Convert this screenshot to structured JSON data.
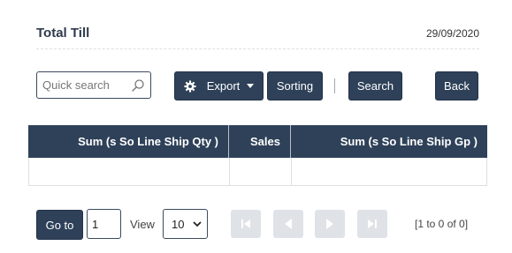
{
  "header": {
    "title": "Total Till",
    "date": "29/09/2020"
  },
  "toolbar": {
    "search_placeholder": "Quick search",
    "search_value": "",
    "export_label": "Export",
    "sorting_label": "Sorting",
    "search_label": "Search",
    "back_label": "Back"
  },
  "grid": {
    "columns": [
      "Sum (s So Line Ship Qty )",
      "Sales",
      "Sum (s So Line Ship Gp )"
    ],
    "rows": [
      [
        "",
        "",
        ""
      ]
    ]
  },
  "pager": {
    "goto_label": "Go to",
    "page_value": "1",
    "view_label": "View",
    "page_size": "10",
    "info": "[1 to 0 of 0]"
  },
  "icons": [
    "search-icon",
    "gear-icon",
    "caret-down-icon",
    "chevron-down-icon",
    "first-page-icon",
    "prev-page-icon",
    "next-page-icon",
    "last-page-icon"
  ],
  "colors": {
    "primary": "#2e4159",
    "disabled": "#dfe2e6",
    "text": "#2e3a4c"
  }
}
